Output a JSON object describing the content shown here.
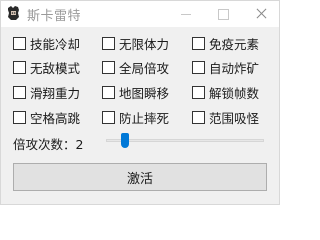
{
  "window": {
    "title": "斯卡雷特",
    "icon": "app-character-icon"
  },
  "options": [
    [
      {
        "label": "技能冷却",
        "checked": false
      },
      {
        "label": "无限体力",
        "checked": false
      },
      {
        "label": "免疫元素",
        "checked": false
      }
    ],
    [
      {
        "label": "无敌模式",
        "checked": false
      },
      {
        "label": "全局倍攻",
        "checked": false
      },
      {
        "label": "自动炸矿",
        "checked": false
      }
    ],
    [
      {
        "label": "滑翔重力",
        "checked": false
      },
      {
        "label": "地图瞬移",
        "checked": false
      },
      {
        "label": "解锁帧数",
        "checked": false
      }
    ],
    [
      {
        "label": "空格高跳",
        "checked": false
      },
      {
        "label": "防止摔死",
        "checked": false
      },
      {
        "label": "范围吸怪",
        "checked": false
      }
    ]
  ],
  "attack_multiplier": {
    "label": "倍攻次数：2",
    "slider_value": 2
  },
  "activate_button": "激活",
  "colors": {
    "accent": "#0078d7",
    "panel_bg": "#f0f0f0",
    "button_bg": "#e1e1e1"
  }
}
